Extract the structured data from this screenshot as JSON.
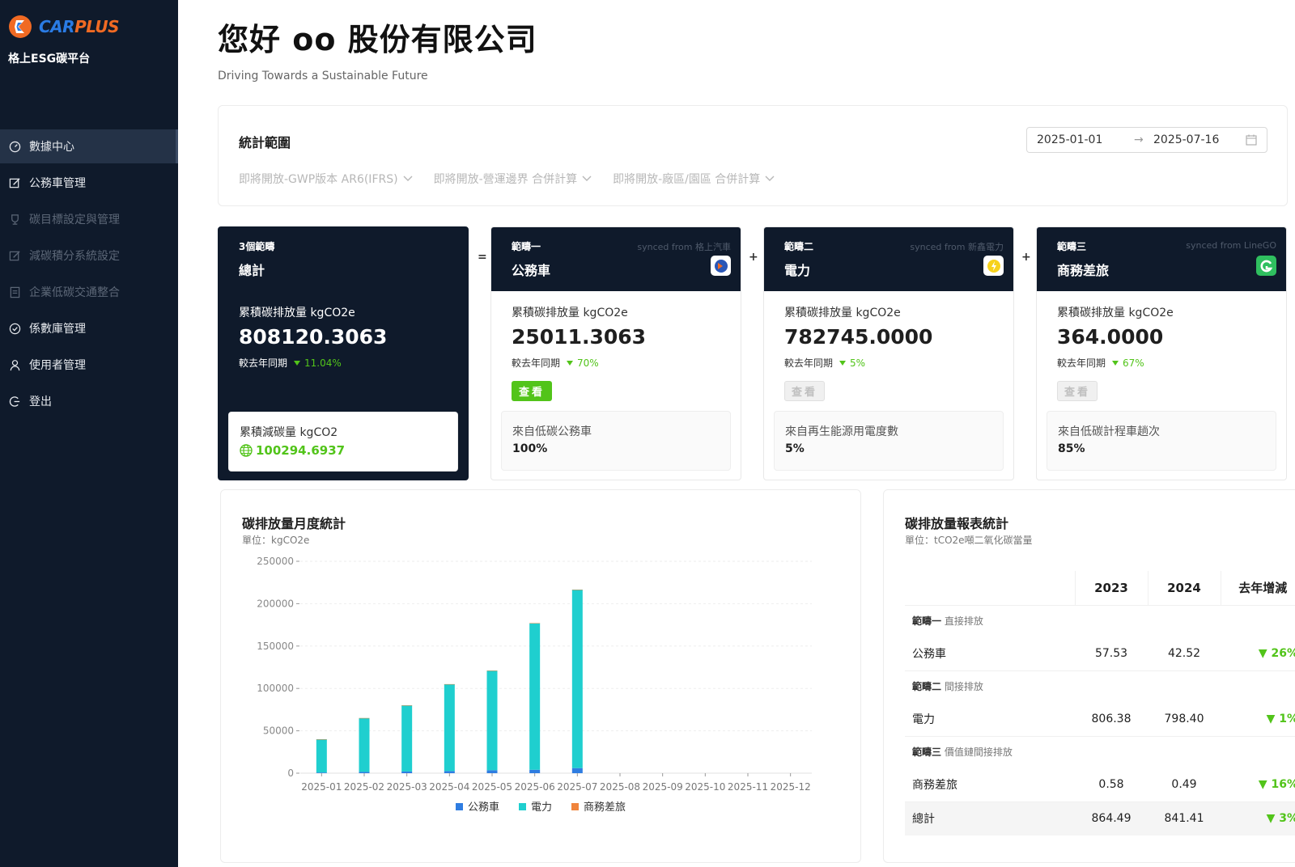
{
  "brand": {
    "logo_car": "CAR",
    "logo_plus": "PLUS",
    "platform_name": "格上ESG碳平台"
  },
  "nav": {
    "items": [
      {
        "label": "數據中心",
        "icon": "dashboard-icon",
        "active": true,
        "disabled": false
      },
      {
        "label": "公務車管理",
        "icon": "edit-icon",
        "active": false,
        "disabled": false
      },
      {
        "label": "碳目標設定與管理",
        "icon": "trophy-icon",
        "active": false,
        "disabled": true
      },
      {
        "label": "減碳積分系統設定",
        "icon": "edit-icon",
        "active": false,
        "disabled": true
      },
      {
        "label": "企業低碳交通整合",
        "icon": "document-icon",
        "active": false,
        "disabled": true
      },
      {
        "label": "係數庫管理",
        "icon": "check-circle-icon",
        "active": false,
        "disabled": false
      },
      {
        "label": "使用者管理",
        "icon": "user-icon",
        "active": false,
        "disabled": false
      },
      {
        "label": "登出",
        "icon": "logout-icon",
        "active": false,
        "disabled": false
      }
    ]
  },
  "header": {
    "greeting": "您好 oo 股份有限公司",
    "subtitle": "Driving Towards a Sustainable Future"
  },
  "range": {
    "title": "統計範圍",
    "filters": [
      "即將開放-GWP版本 AR6(IFRS)",
      "即將開放-營運邊界 合併計算",
      "即將開放-廠區/園區 合併計算"
    ],
    "start_date": "2025-01-01",
    "end_date": "2025-07-16",
    "arrow": "→"
  },
  "cards": {
    "total": {
      "scope": "3個範疇",
      "name": "總計",
      "label": "累積碳排放量 kgCO2e",
      "value": "808120.3063",
      "yoy_label": "較去年同期",
      "yoy_pct": "11.04%",
      "reduction_label": "累積減碳量 kgCO2",
      "reduction_value": "100294.6937"
    },
    "scope1": {
      "scope": "範疇一",
      "name": "公務車",
      "synced": "synced from 格上汽車",
      "label": "累積碳排放量 kgCO2e",
      "value": "25011.3063",
      "yoy_label": "較去年同期",
      "yoy_pct": "70%",
      "button": "查看",
      "button_enabled": true,
      "sub_title": "來自低碳公務車",
      "sub_value": "100%",
      "badge_color": "#ffffff"
    },
    "scope2": {
      "scope": "範疇二",
      "name": "電力",
      "synced": "synced from 新鑫電力",
      "label": "累積碳排放量 kgCO2e",
      "value": "782745.0000",
      "yoy_label": "較去年同期",
      "yoy_pct": "5%",
      "button": "查看",
      "button_enabled": false,
      "sub_title": "來自再生能源用電度數",
      "sub_value": "5%",
      "badge_color": "#ffffff"
    },
    "scope3": {
      "scope": "範疇三",
      "name": "商務差旅",
      "synced": "synced from LineGO",
      "label": "累積碳排放量 kgCO2e",
      "value": "364.0000",
      "yoy_label": "較去年同期",
      "yoy_pct": "67%",
      "button": "查看",
      "button_enabled": false,
      "sub_title": "來自低碳計程車趟次",
      "sub_value": "85%",
      "badge_color": "#2fbf5f"
    },
    "ops": [
      "=",
      "+",
      "+"
    ]
  },
  "monthly_chart": {
    "title": "碳排放量月度統計",
    "unit": "單位：kgCO2e"
  },
  "chart_data": {
    "type": "bar",
    "stacked": true,
    "categories": [
      "2025-01",
      "2025-02",
      "2025-03",
      "2025-04",
      "2025-05",
      "2025-06",
      "2025-07",
      "2025-08",
      "2025-09",
      "2025-10",
      "2025-11",
      "2025-12"
    ],
    "series": [
      {
        "name": "公務車",
        "color": "#2f7de1",
        "values": [
          800,
          1500,
          2000,
          2500,
          3500,
          4000,
          6000,
          0,
          0,
          0,
          0,
          0
        ]
      },
      {
        "name": "電力",
        "color": "#1fcfcf",
        "values": [
          39200,
          63500,
          78000,
          102500,
          117500,
          173000,
          210500,
          0,
          0,
          0,
          0,
          0
        ]
      },
      {
        "name": "商務差旅",
        "color": "#f0843c",
        "values": [
          50,
          50,
          50,
          50,
          50,
          50,
          60,
          0,
          0,
          0,
          0,
          0
        ]
      }
    ],
    "ylim": [
      0,
      250000
    ],
    "yticks": [
      0,
      50000,
      100000,
      150000,
      200000,
      250000
    ],
    "grid": true,
    "legend": "bottom"
  },
  "report": {
    "title": "碳排放量報表統計",
    "unit": "單位：tCO2e噸二氧化碳當量",
    "columns": [
      "2023",
      "2024",
      "去年增減"
    ],
    "groups": [
      {
        "scope": "範疇一",
        "desc": "直接排放",
        "row": {
          "name": "公務車",
          "v2023": "57.53",
          "v2024": "42.52",
          "change": "▼ 26%"
        }
      },
      {
        "scope": "範疇二",
        "desc": "間接排放",
        "row": {
          "name": "電力",
          "v2023": "806.38",
          "v2024": "798.40",
          "change": "▼ 1%"
        }
      },
      {
        "scope": "範疇三",
        "desc": "價值鏈間接排放",
        "row": {
          "name": "商務差旅",
          "v2023": "0.58",
          "v2024": "0.49",
          "change": "▼ 16%"
        }
      }
    ],
    "total": {
      "name": "總計",
      "v2023": "864.49",
      "v2024": "841.41",
      "change": "▼ 3%"
    }
  }
}
